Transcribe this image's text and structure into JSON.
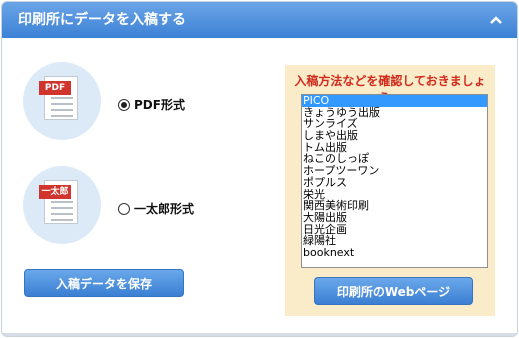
{
  "header": {
    "title": "印刷所にデータを入稿する",
    "collapse_icon": "chevron-up-icon"
  },
  "formats": {
    "pdf": {
      "tag": "PDF",
      "label": "PDF形式",
      "selected": true
    },
    "ichitaro": {
      "tag": "一太郎",
      "label": "一太郎形式",
      "selected": false
    }
  },
  "save_button": {
    "label": "入稿データを保存"
  },
  "printers": {
    "title": "入稿方法などを確認しておきましょう。",
    "items": [
      "PICO",
      "きょうゆう出版",
      "サンライズ",
      "しまや出版",
      "トム出版",
      "ねこのしっぽ",
      "ホープツーワン",
      "ポプルス",
      "栄光",
      "関西美術印刷",
      "大陽出版",
      "日光企画",
      "緑陽社",
      "booknext"
    ],
    "selected": "PICO",
    "web_button": "印刷所のWebページ"
  },
  "colors": {
    "header": "#3d82d6",
    "accent_red": "#d12a1c",
    "panel_bg": "#fbecc9",
    "selection": "#3399ff"
  }
}
